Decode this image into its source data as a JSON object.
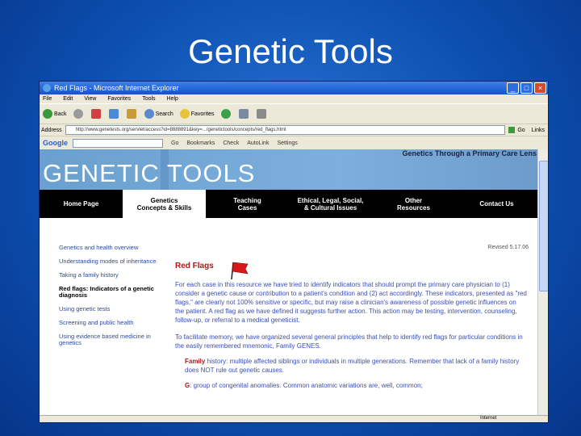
{
  "slide_title": "Genetic Tools",
  "browser": {
    "window_title": "Red Flags - Microsoft Internet Explorer",
    "menu": [
      "File",
      "Edit",
      "View",
      "Favorites",
      "Tools",
      "Help"
    ],
    "toolbar": [
      "Back",
      "Search",
      "Favorites"
    ],
    "address_label": "Address",
    "address_value": "http://www.genetests.org/servlet/access?id=8888891&key=.../genetictools/concepts/red_flags.html",
    "go_label": "Go",
    "links_label": "Links",
    "google_bar": [
      "Google",
      "Go",
      "Bookmarks",
      "Check",
      "AutoLink",
      "Settings"
    ],
    "status_zone": "Internet"
  },
  "site": {
    "logo": "GENETIC TOOLS",
    "tagline": "Genetics Through a Primary Care Lens",
    "nav": [
      {
        "line1": "Home Page",
        "line2": "",
        "active": false
      },
      {
        "line1": "Genetics",
        "line2": "Concepts & Skills",
        "active": true
      },
      {
        "line1": "Teaching",
        "line2": "Cases",
        "active": false
      },
      {
        "line1": "Ethical, Legal, Social,",
        "line2": "& Cultural Issues",
        "active": false
      },
      {
        "line1": "Other",
        "line2": "Resources",
        "active": false
      },
      {
        "line1": "Contact Us",
        "line2": "",
        "active": false
      }
    ],
    "left_links": [
      "Genetics and health overview",
      "Understanding modes of inheritance",
      "Taking a family history",
      "Red flags: Indicators of a genetic diagnosis",
      "Using genetic tests",
      "Screening and public health",
      "Using evidence based medicine in genetics"
    ],
    "revised": "Revised 5.17.06",
    "heading": "Red Flags",
    "para1": "For each case in this resource we have tried to identify indicators that should prompt the primary care physician to (1) consider a genetic cause or contribution to a patient's condition and (2) act accordingly. These indicators, presented as \"red flags,\" are clearly not 100% sensitive or specific, but may raise a clinician's awareness of possible genetic influences on the patient. A red flag as we have defined it suggests further action. This action may be testing, intervention, counseling, follow-up, or referral to a medical geneticist.",
    "para2": "To facilitate memory, we have organized several general principles that help to identify red flags for particular conditions in the easily remembered mnemonic, Family GENES.",
    "bullet1_label": "Family",
    "bullet1_text": " history: multiple affected siblings or individuals in multiple generations. Remember that lack of a family history does NOT rule out genetic causes.",
    "bullet2_label": "G",
    "bullet2_text": ": group of congenital anomalies. Common anatomic variations are, well, common;"
  }
}
